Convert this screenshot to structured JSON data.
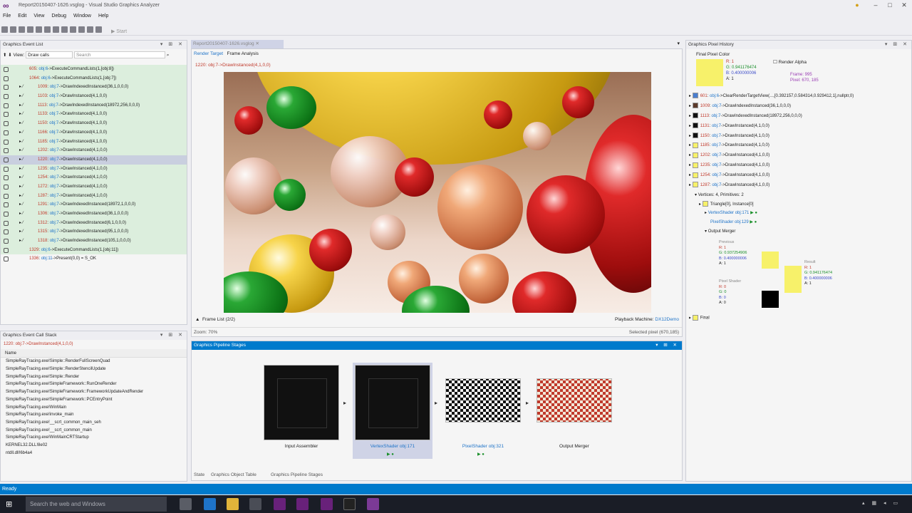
{
  "window": {
    "title": "Report20150407-1626.vsglog - Visual Studio Graphics Analyzer"
  },
  "menu": [
    "File",
    "Edit",
    "View",
    "Debug",
    "Window",
    "Help"
  ],
  "toolbar": {
    "start_label": "Start"
  },
  "event_list": {
    "title": "Graphics Event List",
    "view_label": "View:",
    "view_value": "Draw calls",
    "search_placeholder": "Search",
    "rows": [
      {
        "num": "605",
        "obj": "obj:6",
        "call": "->ExecuteCommandLists(1,[obj:8])",
        "style": "green"
      },
      {
        "num": "1064",
        "obj": "obj:6",
        "call": "->ExecuteCommandLists(1,[obj:7])",
        "style": "green"
      },
      {
        "num": "1009",
        "obj": "obj:7",
        "call": "->DrawIndexedInstanced(36,1,0,0,0)",
        "style": "green"
      },
      {
        "num": "1103",
        "obj": "obj:7",
        "call": "->DrawInstanced(4,1,0,0)",
        "style": "green"
      },
      {
        "num": "1113",
        "obj": "obj:7",
        "call": "->DrawIndexedInstanced(18972,256,0,0,0)",
        "style": "green"
      },
      {
        "num": "1133",
        "obj": "obj:7",
        "call": "->DrawInstanced(4,1,0,0)",
        "style": "green"
      },
      {
        "num": "1150",
        "obj": "obj:7",
        "call": "->DrawInstanced(4,1,0,0)",
        "style": "green"
      },
      {
        "num": "1166",
        "obj": "obj:7",
        "call": "->DrawInstanced(4,1,0,0)",
        "style": "green"
      },
      {
        "num": "1185",
        "obj": "obj:7",
        "call": "->DrawInstanced(4,1,0,0)",
        "style": "green"
      },
      {
        "num": "1202",
        "obj": "obj:7",
        "call": "->DrawInstanced(4,1,0,0)",
        "style": "green"
      },
      {
        "num": "1220",
        "obj": "obj:7",
        "call": "->DrawInstanced(4,1,0,0)",
        "style": "sel"
      },
      {
        "num": "1235",
        "obj": "obj:7",
        "call": "->DrawInstanced(4,1,0,0)",
        "style": "green"
      },
      {
        "num": "1254",
        "obj": "obj:7",
        "call": "->DrawInstanced(4,1,0,0)",
        "style": "green"
      },
      {
        "num": "1272",
        "obj": "obj:7",
        "call": "->DrawInstanced(4,1,0,0)",
        "style": "green"
      },
      {
        "num": "1287",
        "obj": "obj:7",
        "call": "->DrawInstanced(4,1,0,0)",
        "style": "green"
      },
      {
        "num": "1291",
        "obj": "obj:7",
        "call": "->DrawIndexedInstanced(18972,1,0,0,0)",
        "style": "green"
      },
      {
        "num": "1306",
        "obj": "obj:7",
        "call": "->DrawIndexedInstanced(36,1,0,0,0)",
        "style": "green"
      },
      {
        "num": "1312",
        "obj": "obj:7",
        "call": "->DrawIndexedInstanced(6,1,0,0,0)",
        "style": "green"
      },
      {
        "num": "1315",
        "obj": "obj:7",
        "call": "->DrawIndexedInstanced(95,1,0,0,0)",
        "style": "green"
      },
      {
        "num": "1318",
        "obj": "obj:7",
        "call": "->DrawIndexedInstanced(105,1,0,0,0)",
        "style": "green"
      },
      {
        "num": "1329",
        "obj": "obj:6",
        "call": "->ExecuteCommandLists(1,[obj:11])",
        "style": "green"
      },
      {
        "num": "1336",
        "obj": "obj:11",
        "call": "->Present(0,0) = S_OK",
        "style": "plain"
      }
    ]
  },
  "call_stack": {
    "title": "Graphics Event Call Stack",
    "current": "1220: obj:7->DrawInstanced(4,1,0,0)",
    "header": "Name",
    "frames": [
      "SimpleRayTracing.exe!Simple::RenderFullScreenQuad",
      "SimpleRayTracing.exe!Simple::RenderStencilUpdate",
      "SimpleRayTracing.exe!Simple::Render",
      "SimpleRayTracing.exe!SimpleFramework::RunOneRender",
      "SimpleRayTracing.exe!SimpleFramework::FrameworkUpdateAndRender",
      "SimpleRayTracing.exe!SimpleFramework::PCEntryPoint",
      "SimpleRayTracing.exe!WinMain",
      "SimpleRayTracing.exe!invoke_main",
      "SimpleRayTracing.exe!__scrt_common_main_seh",
      "SimpleRayTracing.exe!__scrt_common_main",
      "SimpleRayTracing.exe!WinMainCRTStartup",
      "KERNEL32.DLL!8e02",
      "ntdll.dll!6b4a4"
    ]
  },
  "document": {
    "tab": "Report20150407-1626.vsglog",
    "subtabs": [
      "Render Target",
      "Frame Analysis"
    ],
    "current_event": "1220: obj:7->DrawInstanced(4,1,0,0)",
    "frame_list": "Frame List (2/2)",
    "playback_label": "Playback Machine:",
    "playback_value": "DX12Demo",
    "zoom": "Zoom: 70%",
    "selected_pixel": "Selected pixel (670,185)"
  },
  "pipeline": {
    "title": "Graphics Pipeline Stages",
    "stages": [
      "Input Assembler",
      "VertexShader obj:171",
      "PixelShader obj:321",
      "Output Merger"
    ],
    "bottom_tabs": [
      "State",
      "Graphics Object Table",
      "Graphics Pipeline Stages"
    ]
  },
  "pixel_history": {
    "title": "Graphics Pixel History",
    "final_label": "Final Pixel Color",
    "final_color": "#f7f16a",
    "r": "R: 1",
    "g": "G: 0.941176474",
    "b": "B: 0.400000006",
    "a": "A: 1",
    "render_alpha": "Render Alpha",
    "frame": "Frame: 995",
    "pixel": "Pixel: 670, 185",
    "events": [
      {
        "num": "601",
        "obj": "obj:6",
        "call": "->ClearRenderTargetView(...,[0.392157,0.584314,0.929412,1],nullptr,0)",
        "color": "#4a7ecf"
      },
      {
        "num": "1009",
        "obj": "obj:7",
        "call": "->DrawIndexedInstanced(36,1,0,0,0)",
        "color": "#5b3a2a"
      },
      {
        "num": "1113",
        "obj": "obj:7",
        "call": "->DrawIndexedInstanced(18972,256,0,0,0)",
        "color": "#111111"
      },
      {
        "num": "1131",
        "obj": "obj:7",
        "call": "->DrawInstanced(4,1,0,0)",
        "color": "#111111"
      },
      {
        "num": "1150",
        "obj": "obj:7",
        "call": "->DrawInstanced(4,1,0,0)",
        "color": "#111111"
      },
      {
        "num": "1185",
        "obj": "obj:7",
        "call": "->DrawInstanced(4,1,0,0)",
        "color": "#f7f16a"
      },
      {
        "num": "1202",
        "obj": "obj:7",
        "call": "->DrawInstanced(4,1,0,0)",
        "color": "#f7f16a"
      },
      {
        "num": "1235",
        "obj": "obj:7",
        "call": "->DrawInstanced(4,1,0,0)",
        "color": "#f7f16a"
      },
      {
        "num": "1254",
        "obj": "obj:7",
        "call": "->DrawInstanced(4,1,0,0)",
        "color": "#f7f16a"
      },
      {
        "num": "1287",
        "obj": "obj:7",
        "call": "->DrawInstanced(4,1,0,0)",
        "color": "#f7f16a"
      }
    ],
    "vertices": "Vertices: 4, Primitives: 2",
    "triangle": "Triangle[0], Instance[0]",
    "vertex_shader": "VertexShader obj:171",
    "pixel_shader": "PixelShader obj:129",
    "output_merger": "Output Merger",
    "previous_label": "Previous",
    "previous": [
      "R: 1",
      "G: 0.937254906",
      "B: 0.400000006",
      "A: 1"
    ],
    "pixelshader_label": "Pixel Shader",
    "ps_values": [
      "R: 0",
      "G: 0",
      "B: 0",
      "A: 0"
    ],
    "result_label": "Result",
    "result": [
      "R: 1",
      "G: 0.941176474",
      "B: 0.400000006",
      "A: 1"
    ],
    "final": "Final"
  },
  "status": {
    "text": "Ready"
  },
  "taskbar": {
    "search_placeholder": "Search the web and Windows"
  }
}
